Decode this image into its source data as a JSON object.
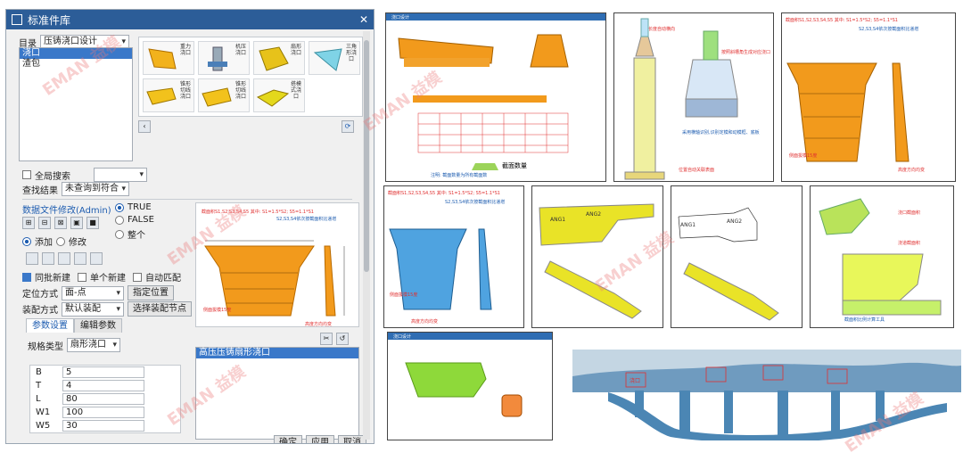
{
  "dialog": {
    "title": "标准件库",
    "catalog_label": "目录",
    "catalog_value": "压铸浇口设计",
    "tree_items": [
      {
        "label": "浇口",
        "selected": true
      },
      {
        "label": "渣包",
        "selected": false
      }
    ],
    "thumbnails": [
      "重力浇口",
      "机压浇口",
      "扇形浇口",
      "三角形浇口",
      "锥形切线浇口",
      "锥形切线浇口",
      "搭模式浇口"
    ],
    "global_search_label": "全局搜索",
    "search_results_label": "查找结果",
    "search_results_value": "未查询到符合",
    "data_file_edit_label": "数据文件修改(Admin)",
    "radio_true": "TRUE",
    "radio_false": "FALSE",
    "radio_whole": "整个",
    "add_label": "添加",
    "modify_label": "修改",
    "same_batch_label": "同批新建",
    "single_new_label": "单个新建",
    "auto_match_label": "自动匹配",
    "position_method_label": "定位方式",
    "position_method_value": "面-点",
    "specify_position_button": "指定位置",
    "assembly_method_label": "装配方式",
    "assembly_method_value": "默认装配",
    "select_assembly_node_button": "选择装配节点",
    "tabs": [
      "参数设置",
      "编辑参数"
    ],
    "spec_type_label": "规格类型",
    "spec_type_value": "扇形浇口",
    "params": [
      {
        "name": "B",
        "value": "5"
      },
      {
        "name": "T",
        "value": "4"
      },
      {
        "name": "L",
        "value": "80"
      },
      {
        "name": "W1",
        "value": "100"
      },
      {
        "name": "W5",
        "value": "30"
      }
    ],
    "result_list_item": "高压压铸扇形浇口",
    "ok_button": "确定",
    "apply_button": "应用",
    "cancel_button": "取消",
    "preview_heading_1": "截面积S1,S2,S3,S4,S5  其中: S1=1.5*S2; S5=1.1*S1",
    "preview_heading_2": "S2,S3,S4依次按截面积比递增",
    "preview_side_label": "侧面拔模15度",
    "preview_height_label": "高度方向均变"
  },
  "panels": {
    "p1": {
      "title": "浇口设计",
      "label1": "截面数量",
      "note": "注明: 截面数量为所有截面数"
    },
    "p2": {
      "label_top": "长度自动横向",
      "label_a": "按照斜槽角生成对应浇口",
      "label_b": "采用横轴识别,识别定模和动模框、底板",
      "label_c": "位置自动关联表面"
    },
    "p3": {
      "heading_1": "截面积S1,S2,S3,S4,S5  其中: S1=1.5*S2; S5=1.1*S1",
      "heading_2": "S2,S3,S4依次按截面积比递增",
      "side": "侧面拔模15度",
      "height": "高度方向均变"
    },
    "p4": {
      "heading_1": "截面积S1,S2,S3,S4,S5  其中: S1=1.5*S2; S5=1.1*S1",
      "heading_2": "S2,S3,S4依次按截面积比递增",
      "side": "侧面拔模15度",
      "height": "高度方向均变"
    },
    "p5": {
      "ang1": "ANG1",
      "ang2": "ANG2"
    },
    "p6": {
      "ang1": "ANG1",
      "ang2": "ANG2"
    },
    "p7": {
      "label_a": "浇口截面积",
      "label_b": "浇道截面积",
      "label_c": "截面积比例计算工具"
    },
    "p8": {
      "title": "浇口设计"
    },
    "p9": {
      "tag": "浇口"
    }
  },
  "watermark": "EMAN 益模",
  "colors": {
    "title_bar": "#2c5d98",
    "selection": "#3a78c9",
    "gate_orange": "#f29a1c",
    "gate_yellow": "#e9e327",
    "gate_blue": "#4fa3e0",
    "gate_green": "#8ed93a",
    "casting_blue": "#4b86b4"
  }
}
